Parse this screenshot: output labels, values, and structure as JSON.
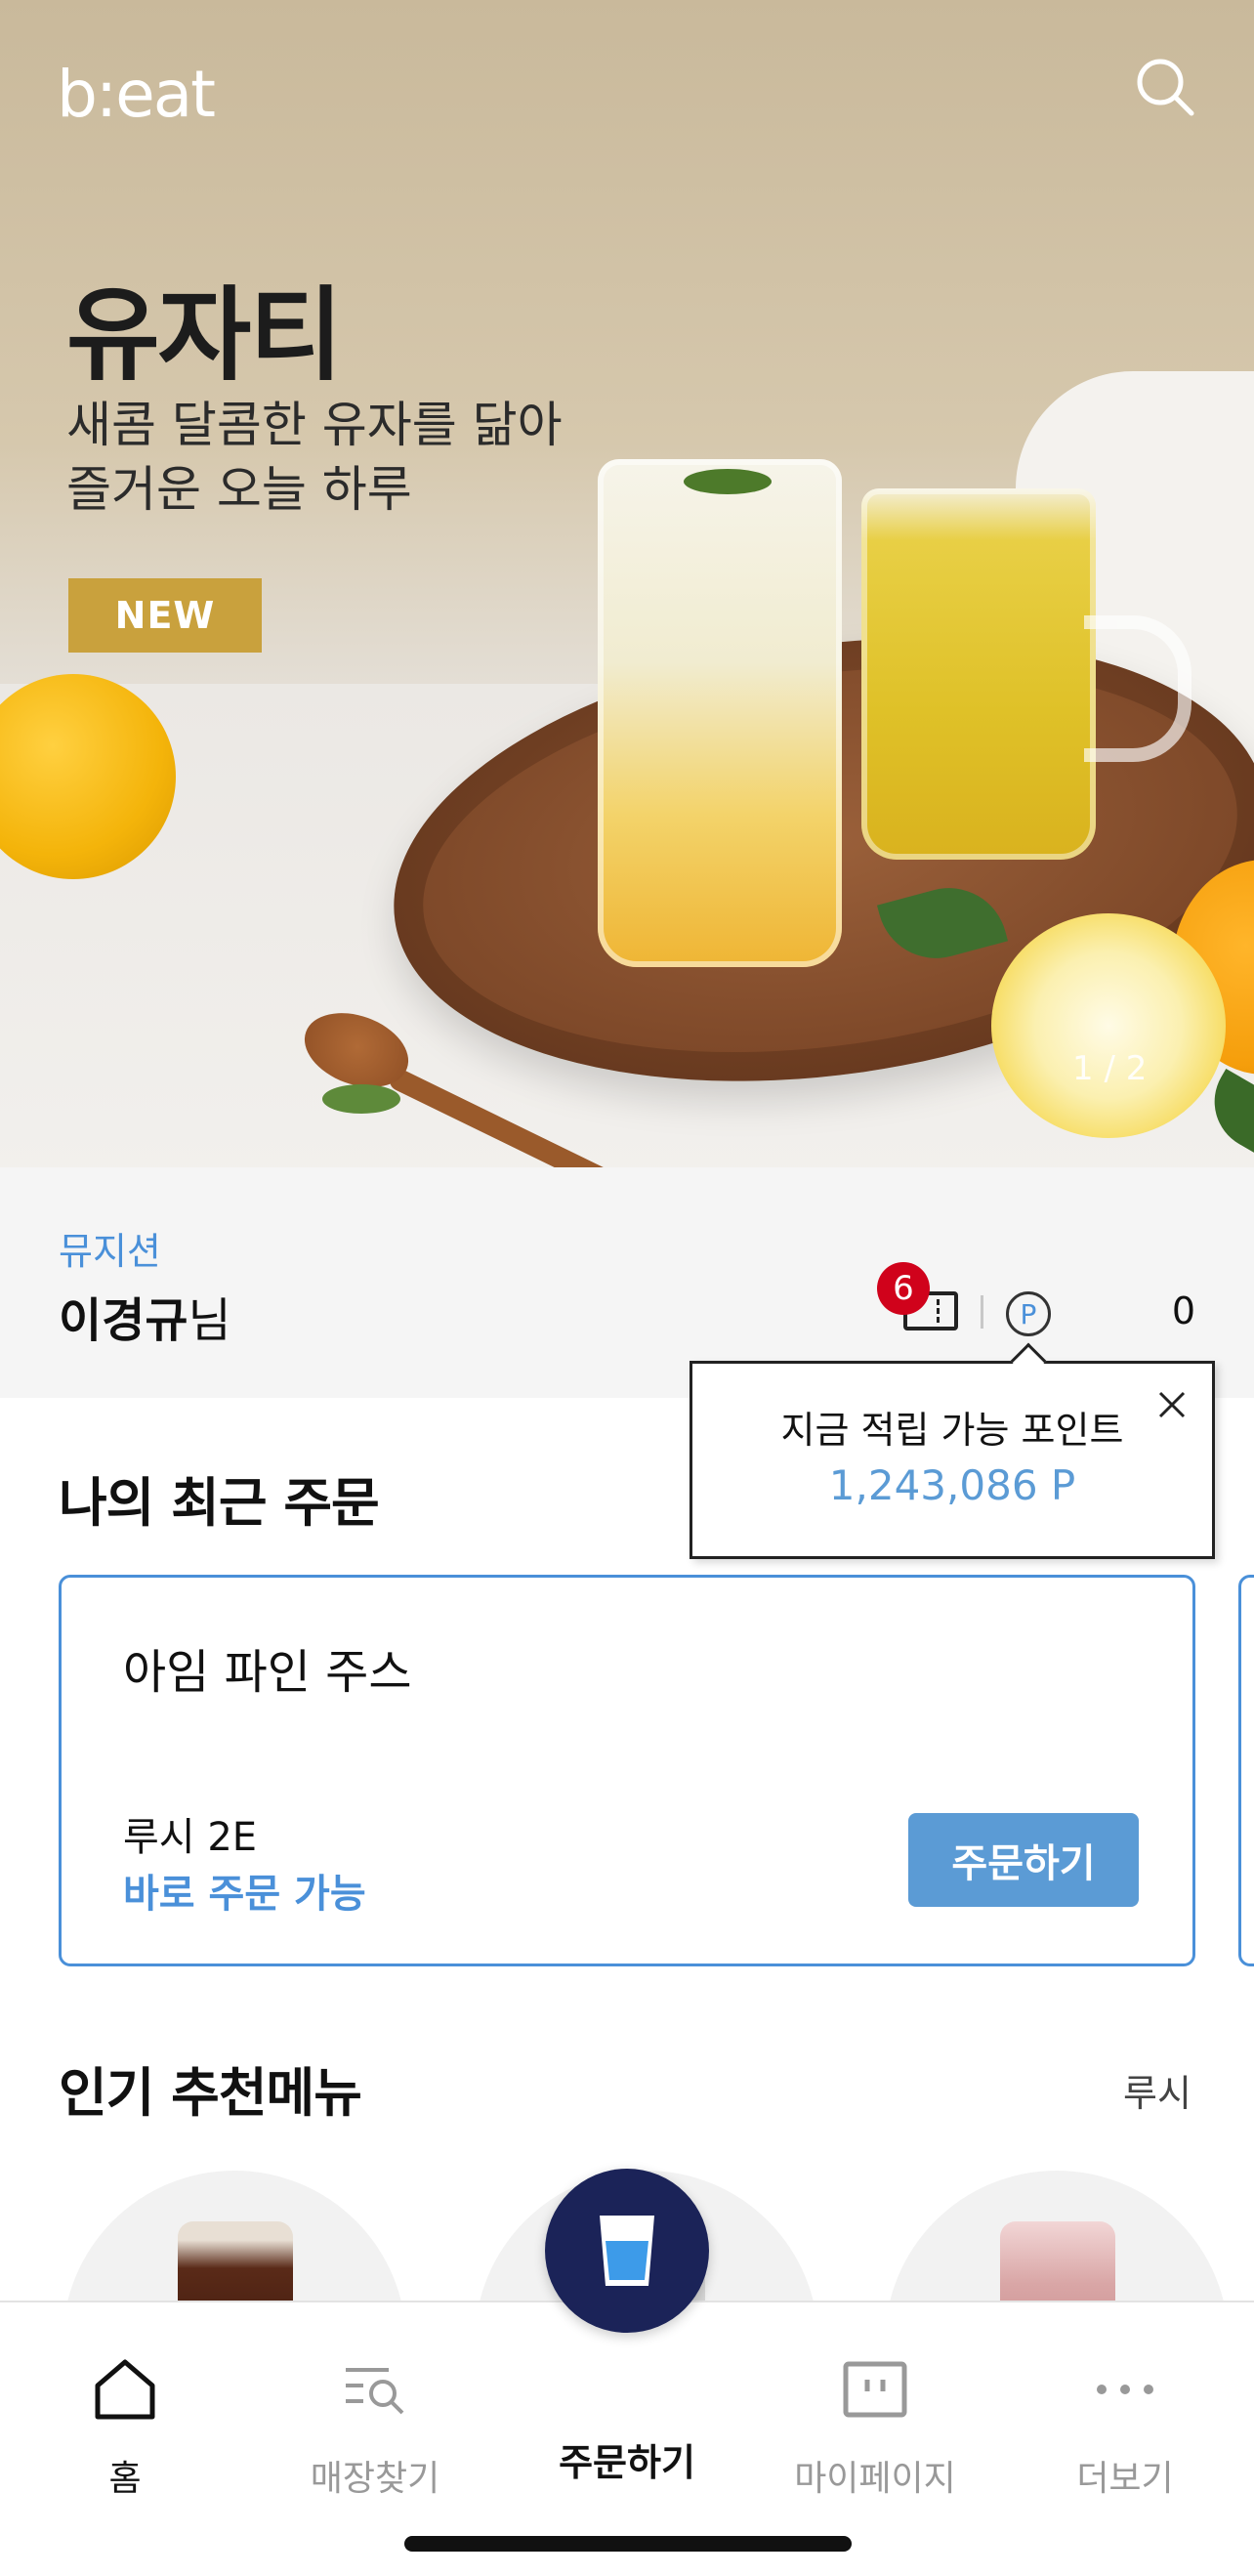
{
  "header": {
    "logo_text": "b:eat",
    "search_icon": "search-icon"
  },
  "banner": {
    "title": "유자티",
    "subtitle_line1": "새콤 달콤한 유자를 닮아",
    "subtitle_line2": "즐거운 오늘 하루",
    "badge": "NEW",
    "pager": "1 / 2"
  },
  "user": {
    "grade": "뮤지션",
    "name": "이경규",
    "honorific": "님",
    "coupon_count": "6",
    "coupon_icon": "coupon-icon",
    "point_icon_label": "P",
    "point_value": "0"
  },
  "tooltip": {
    "title": "지금 적립 가능 포인트",
    "points": "1,243,086 P",
    "close_icon": "close-icon"
  },
  "recent_orders": {
    "title": "나의 최근 주문",
    "card": {
      "menu": "아임 파인 주스",
      "store": "루시 2E",
      "status": "바로 주문 가능",
      "button": "주문하기"
    }
  },
  "popular": {
    "title": "인기 추천메뉴",
    "store_link": "루시"
  },
  "tabbar": {
    "items": [
      {
        "label": "홈",
        "icon": "home-icon"
      },
      {
        "label": "매장찾기",
        "icon": "store-search-icon"
      },
      {
        "label": "주문하기",
        "icon": "cup-icon"
      },
      {
        "label": "마이페이지",
        "icon": "mypage-icon"
      },
      {
        "label": "더보기",
        "icon": "more-icon"
      }
    ]
  },
  "colors": {
    "accent_blue": "#4a90d9",
    "button_blue": "#5b9bd5",
    "badge_gold": "#c9a13d",
    "badge_red": "#d0021b",
    "fab_navy": "#1b2358"
  }
}
